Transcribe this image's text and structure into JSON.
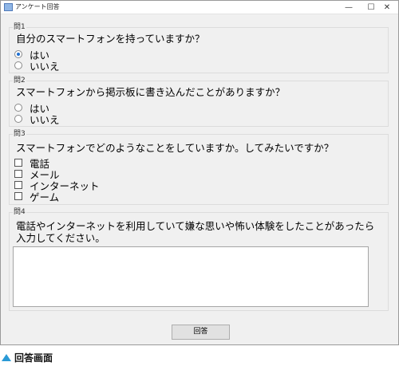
{
  "window": {
    "title": "アンケート回答",
    "controls": {
      "minimize": "—",
      "maximize": "☐",
      "close": "✕"
    }
  },
  "q1": {
    "label": "問1",
    "question": "自分のスマートフォンを持っていますか？",
    "options": [
      {
        "label": "はい",
        "selected": true
      },
      {
        "label": "いいえ",
        "selected": false
      }
    ]
  },
  "q2": {
    "label": "問2",
    "question": "スマートフォンから掲示板に書き込んだことがありますか？",
    "options": [
      {
        "label": "はい",
        "selected": false
      },
      {
        "label": "いいえ",
        "selected": false
      }
    ]
  },
  "q3": {
    "label": "問3",
    "question": "スマートフォンでどのようなことをしていますか。してみたいですか？",
    "options": [
      {
        "label": "電話",
        "checked": false
      },
      {
        "label": "メール",
        "checked": false
      },
      {
        "label": "インターネット",
        "checked": false
      },
      {
        "label": "ゲーム",
        "checked": false
      }
    ]
  },
  "q4": {
    "label": "問4",
    "question": "電話やインターネットを利用していて嫌な思いや怖い体験をしたことがあったら入力してください。",
    "answer": ""
  },
  "submit_label": "回答",
  "caption": "回答画面",
  "colors": {
    "accent": "#2a9ad6",
    "radio_selected": "#1e6fd0"
  }
}
